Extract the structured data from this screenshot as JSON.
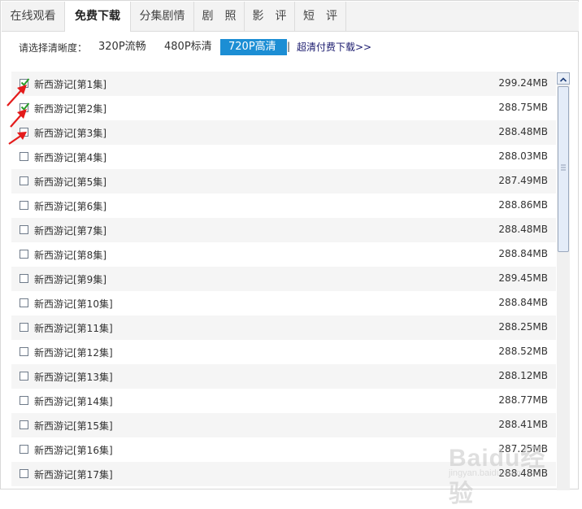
{
  "tabs": [
    {
      "label": "在线观看",
      "active": false
    },
    {
      "label": "免费下载",
      "active": true
    },
    {
      "label": "分集剧情",
      "active": false
    },
    {
      "label": "剧　照",
      "active": false
    },
    {
      "label": "影　评",
      "active": false
    },
    {
      "label": "短　评",
      "active": false
    }
  ],
  "quality": {
    "label": "请选择清晰度：",
    "options": [
      "320P流畅",
      "480P标清",
      "720P高清"
    ],
    "selected": "720P高清",
    "separator": "|",
    "paid_link": "超清付费下载>>"
  },
  "episodes": [
    {
      "title": "新西游记[第1集]",
      "size": "299.24MB",
      "checked": true
    },
    {
      "title": "新西游记[第2集]",
      "size": "288.75MB",
      "checked": true
    },
    {
      "title": "新西游记[第3集]",
      "size": "288.48MB",
      "checked": false
    },
    {
      "title": "新西游记[第4集]",
      "size": "288.03MB",
      "checked": false
    },
    {
      "title": "新西游记[第5集]",
      "size": "287.49MB",
      "checked": false
    },
    {
      "title": "新西游记[第6集]",
      "size": "288.86MB",
      "checked": false
    },
    {
      "title": "新西游记[第7集]",
      "size": "288.48MB",
      "checked": false
    },
    {
      "title": "新西游记[第8集]",
      "size": "288.84MB",
      "checked": false
    },
    {
      "title": "新西游记[第9集]",
      "size": "289.45MB",
      "checked": false
    },
    {
      "title": "新西游记[第10集]",
      "size": "288.84MB",
      "checked": false
    },
    {
      "title": "新西游记[第11集]",
      "size": "288.25MB",
      "checked": false
    },
    {
      "title": "新西游记[第12集]",
      "size": "288.52MB",
      "checked": false
    },
    {
      "title": "新西游记[第13集]",
      "size": "288.12MB",
      "checked": false
    },
    {
      "title": "新西游记[第14集]",
      "size": "288.77MB",
      "checked": false
    },
    {
      "title": "新西游记[第15集]",
      "size": "288.41MB",
      "checked": false
    },
    {
      "title": "新西游记[第16集]",
      "size": "287.25MB",
      "checked": false
    },
    {
      "title": "新西游记[第17集]",
      "size": "288.48MB",
      "checked": false
    }
  ],
  "watermark": {
    "text": "Baidu经验",
    "sub": "jingyan.baidu.com"
  },
  "colors": {
    "accent": "#1c8ed4",
    "check": "#2a9d2a",
    "annotation": "#e41b1b"
  }
}
